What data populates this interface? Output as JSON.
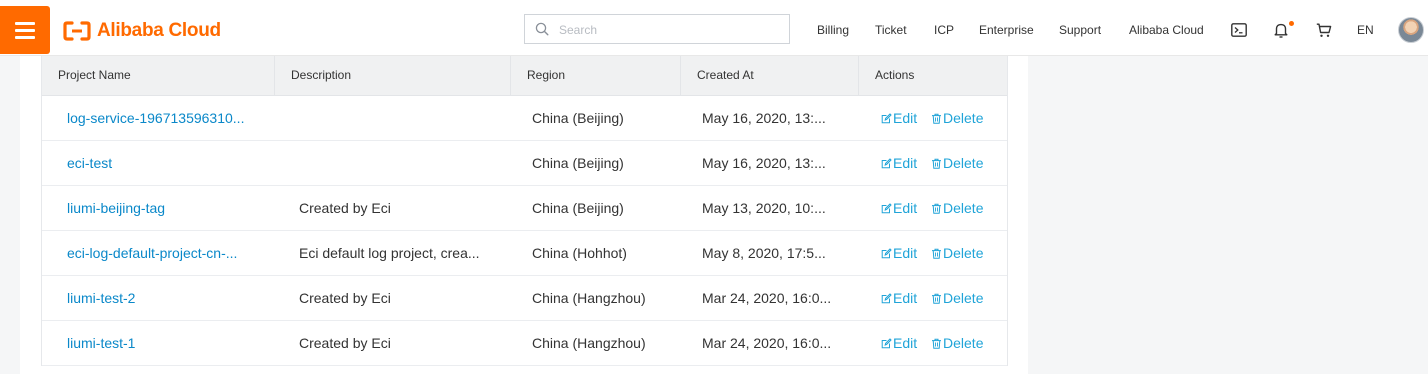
{
  "header": {
    "logo_text": "Alibaba Cloud",
    "search_placeholder": "Search",
    "nav": [
      "Billing",
      "Ticket",
      "ICP",
      "Enterprise",
      "Support",
      "Alibaba Cloud"
    ],
    "language": "EN",
    "brand_color": "#ff6a00",
    "icons": [
      "menu-icon",
      "terminal-icon",
      "bell-icon",
      "cart-icon"
    ]
  },
  "table": {
    "columns": [
      "Project Name",
      "Description",
      "Region",
      "Created At",
      "Actions"
    ],
    "rows": [
      {
        "name": "log-service-196713596310...",
        "description": "",
        "region": "China (Beijing)",
        "created": "May 16, 2020, 13:..."
      },
      {
        "name": "eci-test",
        "description": "",
        "region": "China (Beijing)",
        "created": "May 16, 2020, 13:..."
      },
      {
        "name": "liumi-beijing-tag",
        "description": "Created by Eci",
        "region": "China (Beijing)",
        "created": "May 13, 2020, 10:..."
      },
      {
        "name": "eci-log-default-project-cn-...",
        "description": "Eci default log project, crea...",
        "region": "China (Hohhot)",
        "created": "May 8, 2020, 17:5..."
      },
      {
        "name": "liumi-test-2",
        "description": "Created by Eci",
        "region": "China (Hangzhou)",
        "created": "Mar 24, 2020, 16:0..."
      },
      {
        "name": "liumi-test-1",
        "description": "Created by Eci",
        "region": "China (Hangzhou)",
        "created": "Mar 24, 2020, 16:0..."
      }
    ],
    "actions": {
      "edit": "Edit",
      "delete": "Delete"
    },
    "link_color": "#0a88c9"
  }
}
